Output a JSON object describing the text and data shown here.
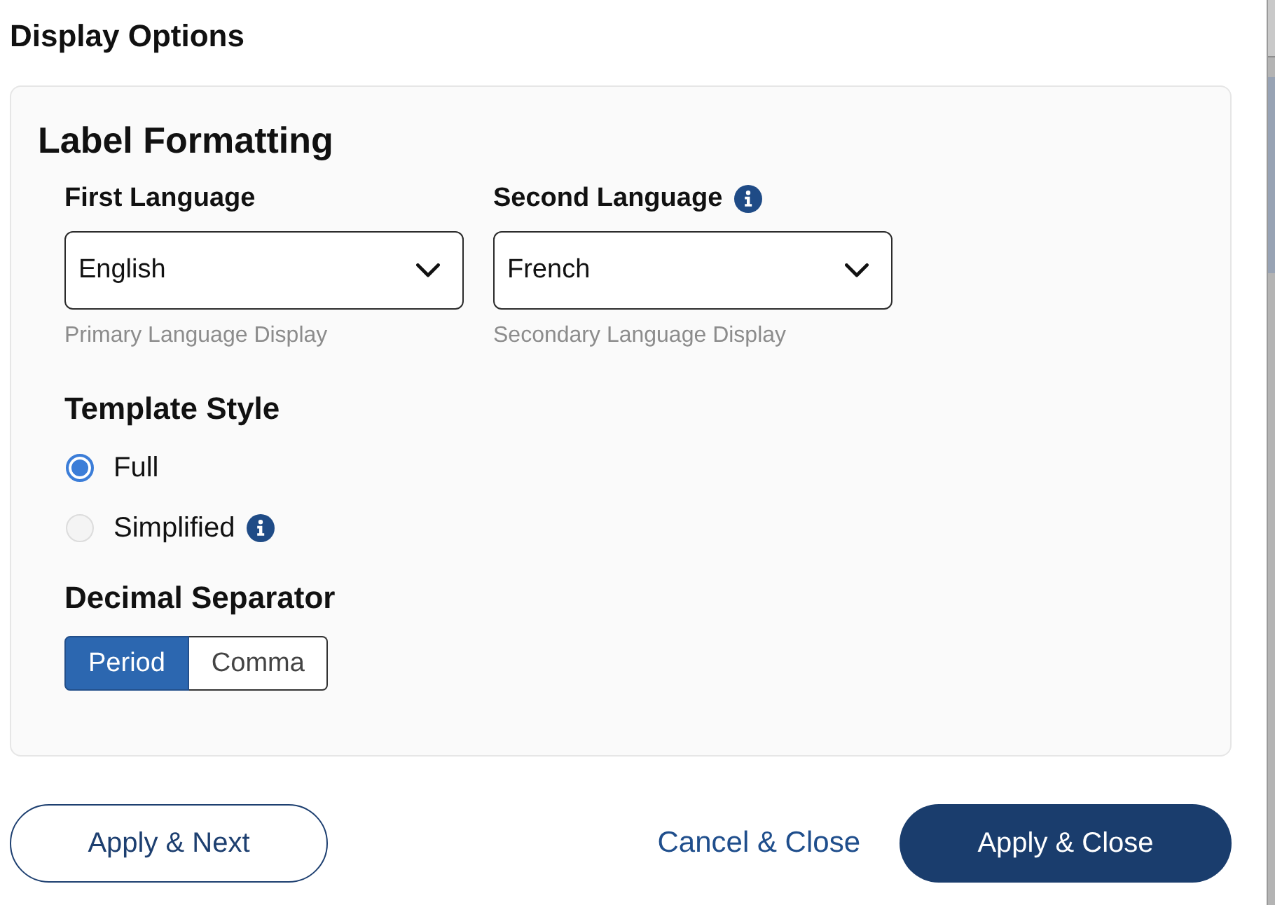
{
  "header": {
    "title": "Display Options"
  },
  "section": {
    "title": "Label Formatting",
    "language_fields": [
      {
        "label": "First Language",
        "info": false,
        "value": "English",
        "helper": "Primary Language Display"
      },
      {
        "label": "Second Language",
        "info": true,
        "value": "French",
        "helper": "Secondary Language Display"
      }
    ],
    "template_style": {
      "title": "Template Style",
      "options": [
        {
          "label": "Full",
          "selected": true,
          "info": false
        },
        {
          "label": "Simplified",
          "selected": false,
          "info": true
        }
      ]
    },
    "decimal_separator": {
      "title": "Decimal Separator",
      "options": [
        {
          "label": "Period",
          "selected": true
        },
        {
          "label": "Comma",
          "selected": false
        }
      ]
    }
  },
  "footer": {
    "buttons": [
      {
        "label": "Apply & Next",
        "kind": "outline"
      },
      {
        "label": "Cancel & Close",
        "kind": "link"
      },
      {
        "label": "Apply & Close",
        "kind": "primary"
      }
    ]
  }
}
